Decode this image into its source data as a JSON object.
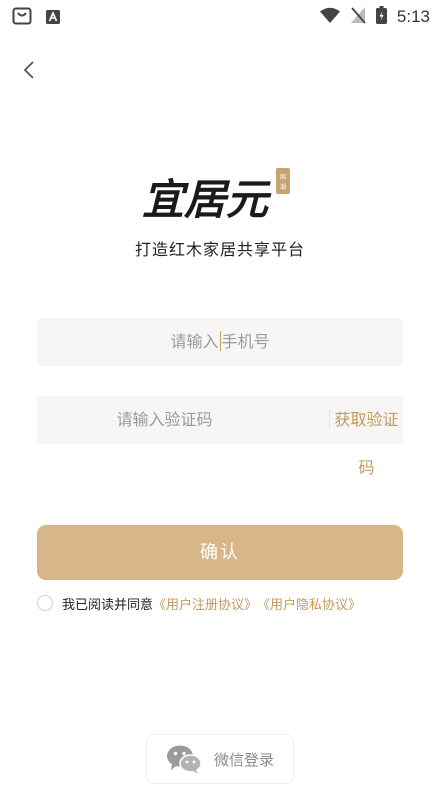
{
  "status_bar": {
    "time": "5:13",
    "icons": [
      "shopping-bag-icon",
      "font-a-icon",
      "wifi-icon",
      "no-sim-icon",
      "battery-charging-icon"
    ]
  },
  "header": {
    "back_icon": "chevron-left-icon"
  },
  "brand": {
    "logo": "宜居元",
    "seal_text": "国潮",
    "slogan": "打造红木家居共享平台"
  },
  "form": {
    "phone_placeholder_before": "请输入",
    "phone_placeholder_after": "手机号",
    "code_placeholder": "请输入验证码",
    "get_code_label": "获取验证码",
    "confirm_label": "确认"
  },
  "agreement": {
    "prefix": "我已阅读并同意",
    "user_agreement": "《用户注册协议》",
    "privacy_policy": "《用户隐私协议》"
  },
  "social_login": {
    "wechat_label": "微信登录",
    "icon": "wechat-icon"
  },
  "colors": {
    "accent": "#c29a5e",
    "button": "#d7b78a",
    "field_bg": "#f7f6f5"
  }
}
